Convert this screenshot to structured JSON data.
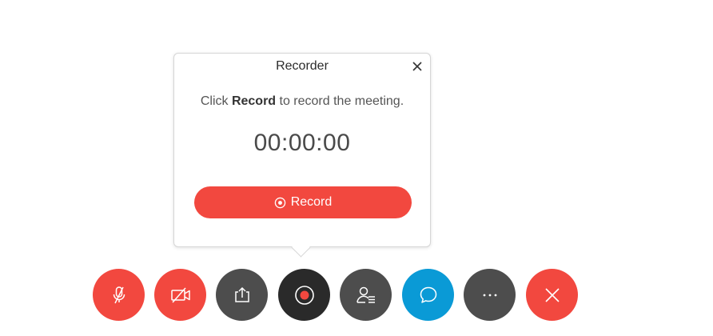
{
  "recorder": {
    "title": "Recorder",
    "instruction_prefix": "Click ",
    "instruction_bold": "Record",
    "instruction_suffix": " to record the meeting.",
    "timer": "00:00:00",
    "record_label": "Record",
    "close_icon": "close-icon"
  },
  "toolbar": {
    "buttons": [
      {
        "name": "mute-microphone",
        "icon": "microphone-off-icon",
        "color": "#f2483f"
      },
      {
        "name": "stop-video",
        "icon": "video-off-icon",
        "color": "#f2483f"
      },
      {
        "name": "share-content",
        "icon": "share-icon",
        "color": "#4d4d4d"
      },
      {
        "name": "record",
        "icon": "record-icon",
        "color": "#2a2a2a"
      },
      {
        "name": "participants",
        "icon": "participants-icon",
        "color": "#4d4d4d"
      },
      {
        "name": "chat",
        "icon": "chat-icon",
        "color": "#0a9ad6"
      },
      {
        "name": "more-options",
        "icon": "more-icon",
        "color": "#4d4d4d"
      },
      {
        "name": "leave-meeting",
        "icon": "close-icon",
        "color": "#f2483f"
      }
    ],
    "more_label": "···"
  },
  "colors": {
    "accent_red": "#f2483f",
    "dark_button": "#4d4d4d",
    "record_button": "#2a2a2a",
    "chat_blue": "#0a9ad6"
  }
}
